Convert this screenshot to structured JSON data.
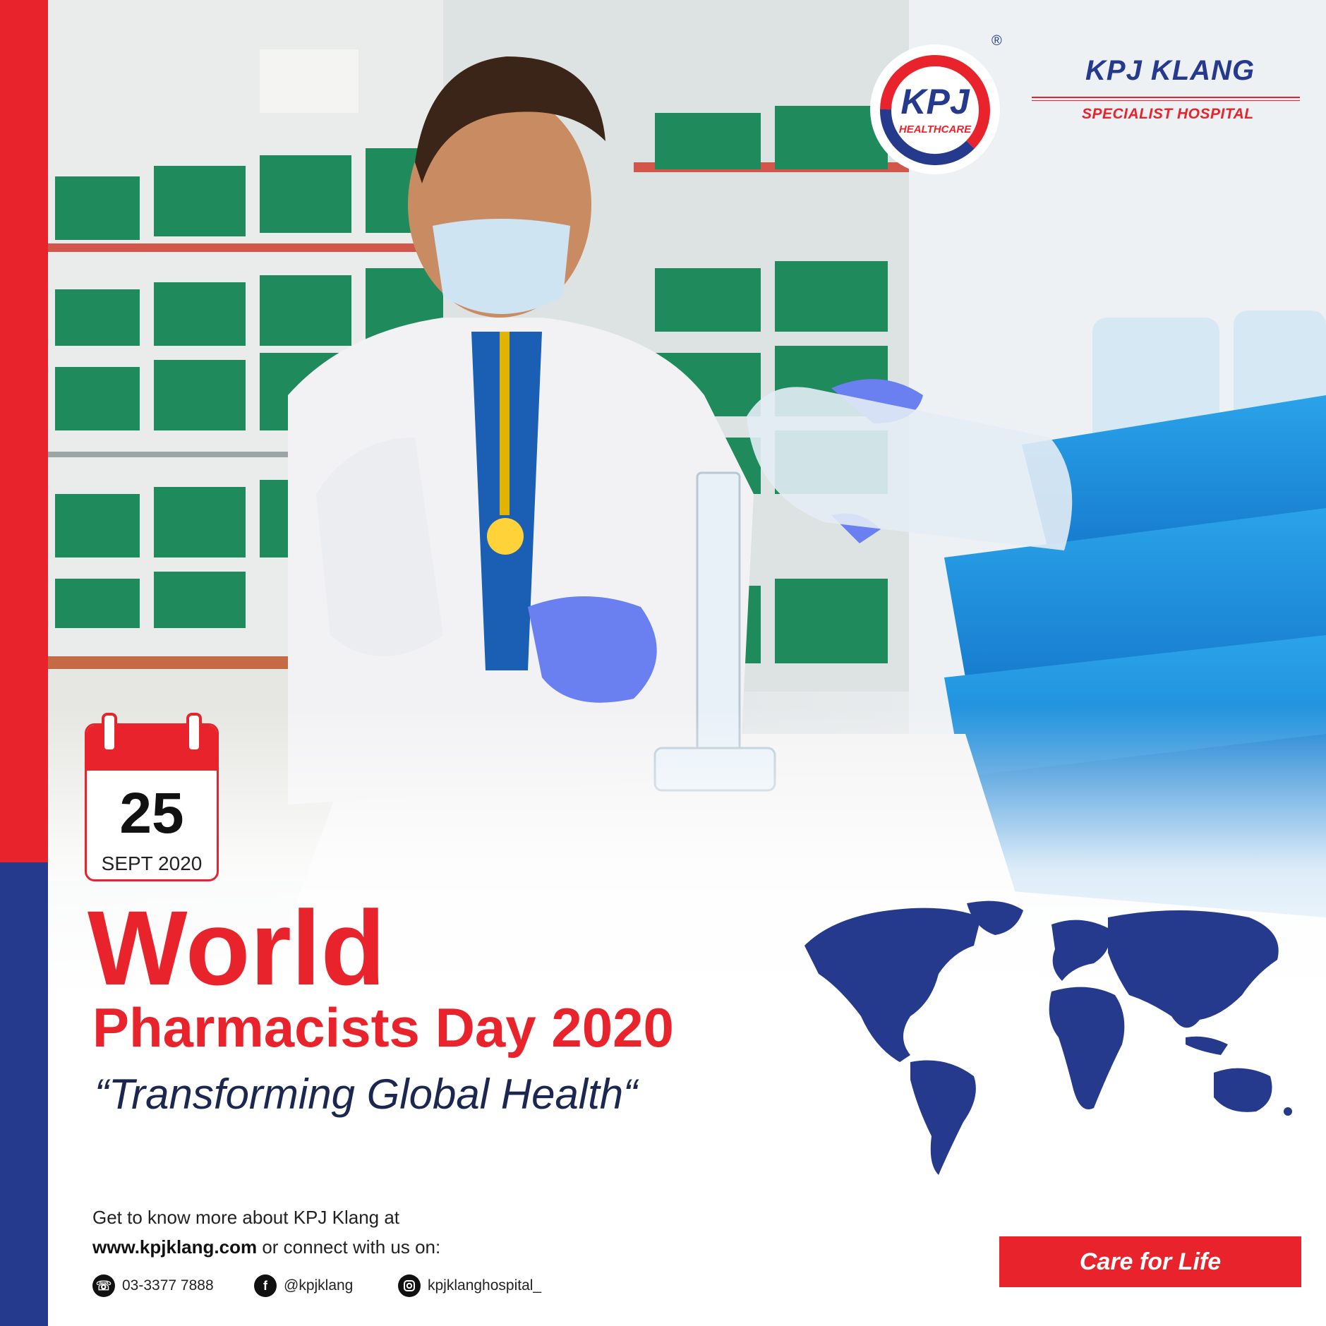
{
  "brand": {
    "logo_text": "KPJ",
    "logo_subtext": "HEALTHCARE",
    "registered_mark": "®",
    "hospital_name": "KPJ KLANG",
    "hospital_type": "SPECIALIST HOSPITAL",
    "colors": {
      "red": "#e8232c",
      "blue": "#253a8d",
      "navy": "#1c2751"
    }
  },
  "date": {
    "day": "25",
    "month_year": "SEPT 2020"
  },
  "headline": {
    "line1": "World",
    "line2": "Pharmacists Day 2020",
    "theme": "“Transforming Global Health“"
  },
  "footer": {
    "intro": "Get to know more about KPJ Klang at",
    "website": "www.kpjklang.com",
    "connect": " or connect with us on:",
    "contacts": [
      {
        "icon": "phone-icon",
        "text": "03-3377 7888"
      },
      {
        "icon": "facebook-icon",
        "text": "@kpjklang"
      },
      {
        "icon": "instagram-icon",
        "text": "kpjklanghospital_"
      }
    ],
    "tagline": "Care for Life"
  }
}
